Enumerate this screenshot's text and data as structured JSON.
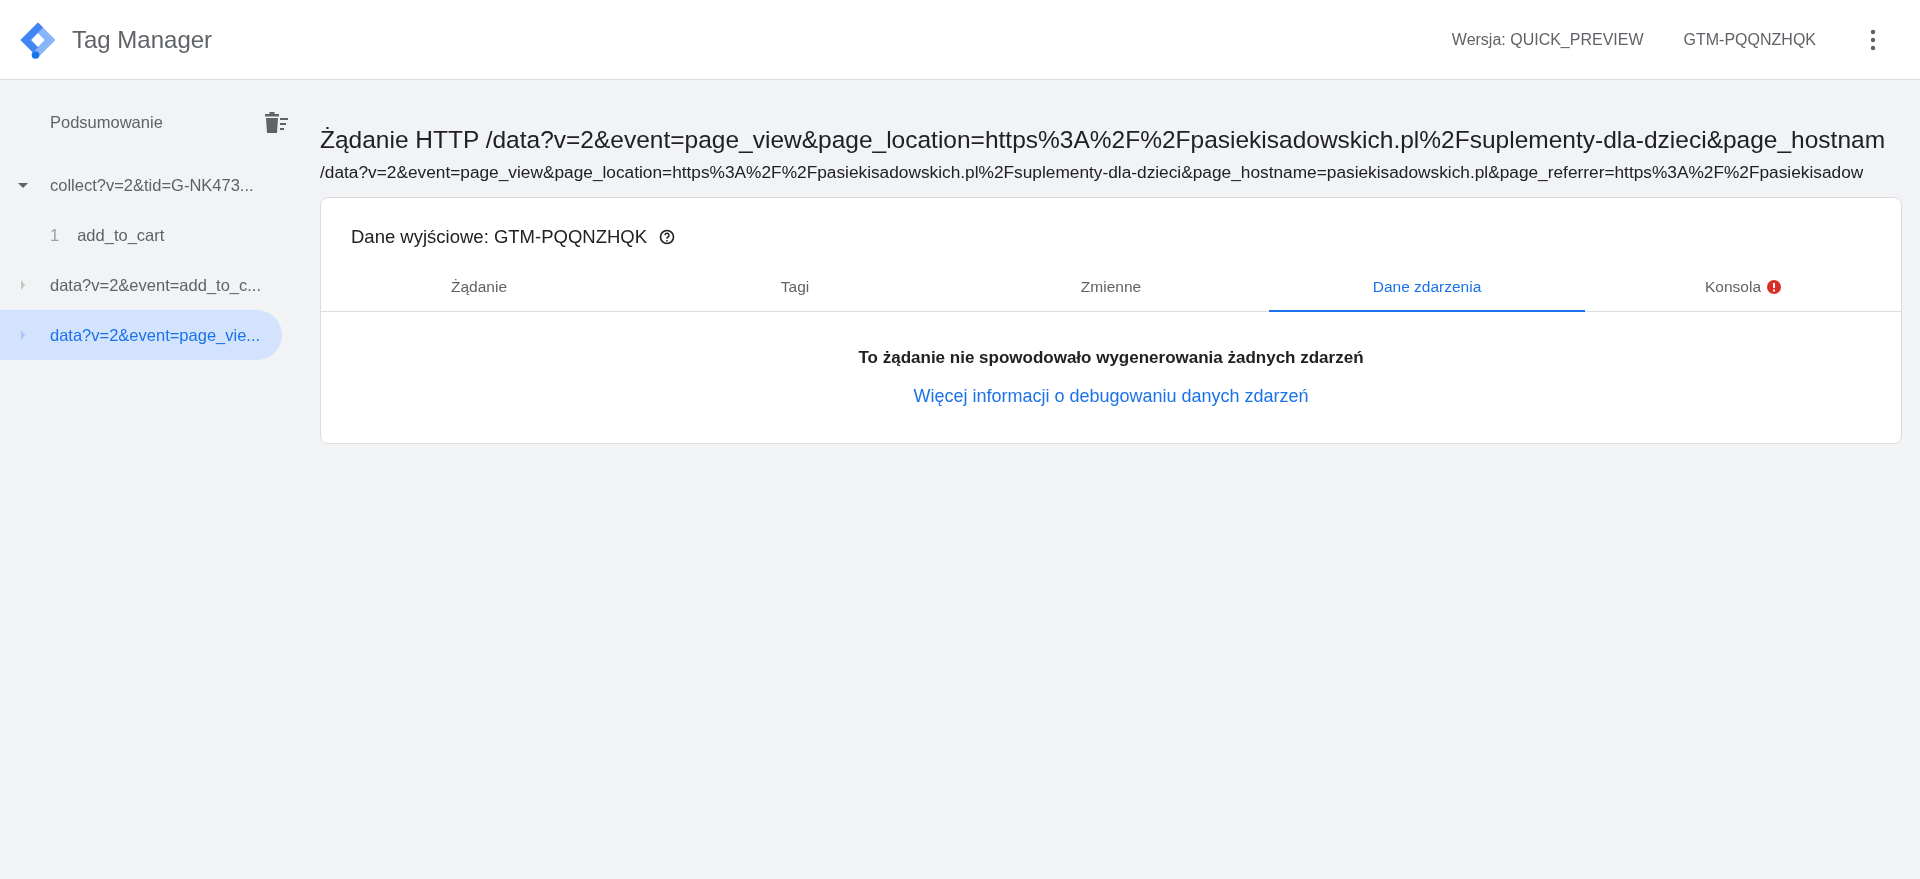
{
  "header": {
    "product": "Tag Manager",
    "version": "Wersja: QUICK_PREVIEW",
    "container": "GTM-PQQNZHQK"
  },
  "sidebar": {
    "summary": "Podsumowanie",
    "items": [
      {
        "label": "collect?v=2&tid=G-NK473...",
        "expanded": true,
        "selected": false,
        "children": [
          {
            "number": "1",
            "label": "add_to_cart",
            "selected": false
          }
        ]
      },
      {
        "label": "data?v=2&event=add_to_c...",
        "expanded": false,
        "selected": false
      },
      {
        "label": "data?v=2&event=page_vie...",
        "expanded": false,
        "selected": true
      }
    ]
  },
  "main": {
    "title": "Żądanie HTTP /data?v=2&event=page_view&page_location=https%3A%2F%2Fpasiekisadowskich.pl%2Fsuplementy-dla-dzieci&page_hostnam",
    "url": "/data?v=2&event=page_view&page_location=https%3A%2F%2Fpasiekisadowskich.pl%2Fsuplementy-dla-dzieci&page_hostname=pasiekisadowskich.pl&page_referrer=https%3A%2F%2Fpasiekisadow",
    "card": {
      "heading": "Dane wyjściowe: GTM-PQQNZHQK",
      "tabs": [
        {
          "label": "Żądanie",
          "selected": false,
          "alert": false
        },
        {
          "label": "Tagi",
          "selected": false,
          "alert": false
        },
        {
          "label": "Zmienne",
          "selected": false,
          "alert": false
        },
        {
          "label": "Dane zdarzenia",
          "selected": true,
          "alert": false
        },
        {
          "label": "Konsola",
          "selected": false,
          "alert": true
        }
      ],
      "message": "To żądanie nie spowodowało wygenerowania żadnych zdarzeń",
      "link": "Więcej informacji o debugowaniu danych zdarzeń"
    }
  }
}
